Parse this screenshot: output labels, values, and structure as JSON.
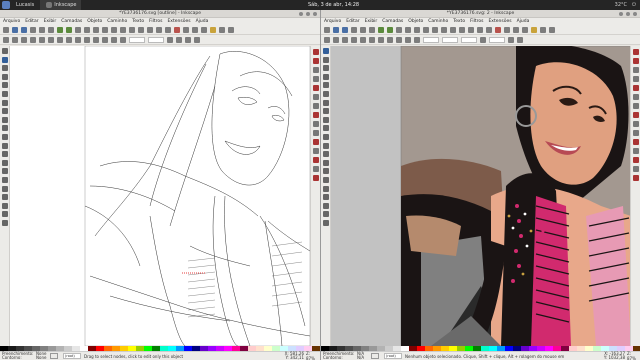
{
  "topbar": {
    "tasks": [
      {
        "label": "Lucasis"
      },
      {
        "label": "Inkscape"
      }
    ],
    "clock": "Sáb, 3 de abr, 14:28",
    "tray": [
      "32°C",
      "⏻"
    ]
  },
  "left_window": {
    "title": "*YE3736176.svg [outline] - Inkscape",
    "menus": [
      "Arquivo",
      "Editar",
      "Exibir",
      "Camadas",
      "Objeto",
      "Caminho",
      "Texto",
      "Filtros",
      "Extensões",
      "Ajuda"
    ],
    "status": {
      "fill_label": "Preenchimento:",
      "stroke_label": "Contorno:",
      "fill_value": "None",
      "stroke_value": "None",
      "layer": "(root)",
      "message": "Drag to select nodes, click to edit only this object",
      "x": "X: 581,26",
      "y": "Y: 342,11",
      "zoom": "Z: 87%"
    }
  },
  "right_window": {
    "title": "*YE3736176.svg: 2 - Inkscape",
    "menus": [
      "Arquivo",
      "Editar",
      "Exibir",
      "Camadas",
      "Objeto",
      "Caminho",
      "Texto",
      "Filtros",
      "Extensões",
      "Ajuda"
    ],
    "status": {
      "fill_label": "Preenchimento:",
      "stroke_label": "Contorno:",
      "fill_value": "N/A",
      "stroke_value": "N/A",
      "layer": "(root)",
      "message": "Nenhum objeto selecionado. Clique, Shift + clique, Alt + rolagem do mouse em",
      "x": "X: -163,27",
      "y": "Y: 1032,38",
      "zoom": "Z: 87%"
    }
  },
  "palette_colors": [
    "#000000",
    "#1a1a1a",
    "#333333",
    "#4d4d4d",
    "#666666",
    "#808080",
    "#999999",
    "#b3b3b3",
    "#cccccc",
    "#e6e6e6",
    "#ffffff",
    "#800000",
    "#ff0000",
    "#ff6600",
    "#ff9900",
    "#ffcc00",
    "#ffff00",
    "#99cc00",
    "#00ff00",
    "#008000",
    "#00ffcc",
    "#00ffff",
    "#0099ff",
    "#0000ff",
    "#000080",
    "#6600cc",
    "#9900ff",
    "#cc00ff",
    "#ff00ff",
    "#ff0099",
    "#800040",
    "#ffcccc",
    "#ffe0cc",
    "#ffffcc",
    "#ccffcc",
    "#ccffff",
    "#cce0ff",
    "#e0ccff",
    "#ffccf0",
    "#663300"
  ],
  "colors": {
    "canvas_bg": "#c2c2c2",
    "skin": "#e8a88a",
    "hair": "#1a1414",
    "accent_pink": "#d12a6e"
  }
}
